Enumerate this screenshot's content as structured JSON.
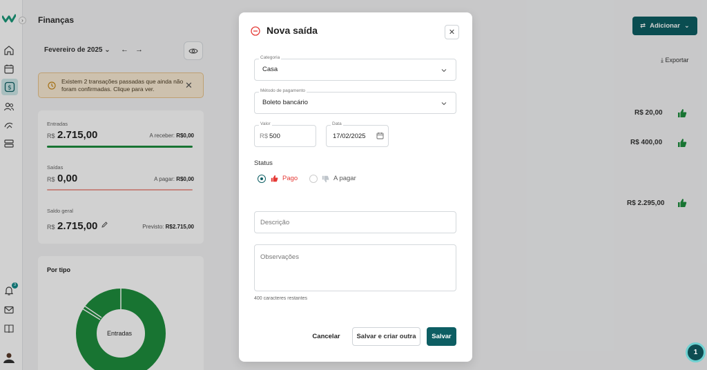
{
  "app": {
    "title": "Finanças",
    "month": "Fevereiro de 2025",
    "alert": "Existem 2 transações passadas que ainda não foram confirmadas. Clique para ver.",
    "notifications_count": "3",
    "add_button": "Adicionar",
    "export": "Exportar",
    "fab_count": "1"
  },
  "summary": {
    "currency": "R$",
    "entradas": {
      "label": "Entradas",
      "value": "2.715,00",
      "side_label": "A receber:",
      "side_value": "R$0,00"
    },
    "saidas": {
      "label": "Saídas",
      "value": "0,00",
      "side_label": "A pagar:",
      "side_value": "R$0,00"
    },
    "saldo": {
      "label": "Saldo geral",
      "value": "2.715,00",
      "side_label": "Previsto:",
      "side_value": "R$2.715,00"
    }
  },
  "by_type": {
    "title": "Por tipo",
    "center_label": "Entradas"
  },
  "list_amounts": [
    "R$ 20,00",
    "R$ 400,00",
    "R$ 2.295,00"
  ],
  "modal": {
    "title": "Nova saída",
    "categoria": {
      "label": "Categoria",
      "value": "Casa"
    },
    "metodo": {
      "label": "Método de pagamento",
      "value": "Boleto bancário"
    },
    "valor": {
      "label": "Valor",
      "prefix": "R$",
      "value": "500"
    },
    "data": {
      "label": "Data",
      "value": "17/02/2025"
    },
    "status": {
      "label": "Status",
      "options": [
        {
          "label": "Pago",
          "selected": true
        },
        {
          "label": "A pagar",
          "selected": false
        }
      ]
    },
    "descricao_placeholder": "Descrição",
    "observacoes_placeholder": "Observações",
    "remaining": "400 caracteres restantes",
    "buttons": {
      "cancel": "Cancelar",
      "save_new": "Salvar e criar outra",
      "save": "Salvar"
    }
  },
  "colors": {
    "primary": "#0d5e63",
    "green": "#1e8e3e",
    "red": "#e53935",
    "alert_bg": "#fbecd5"
  }
}
